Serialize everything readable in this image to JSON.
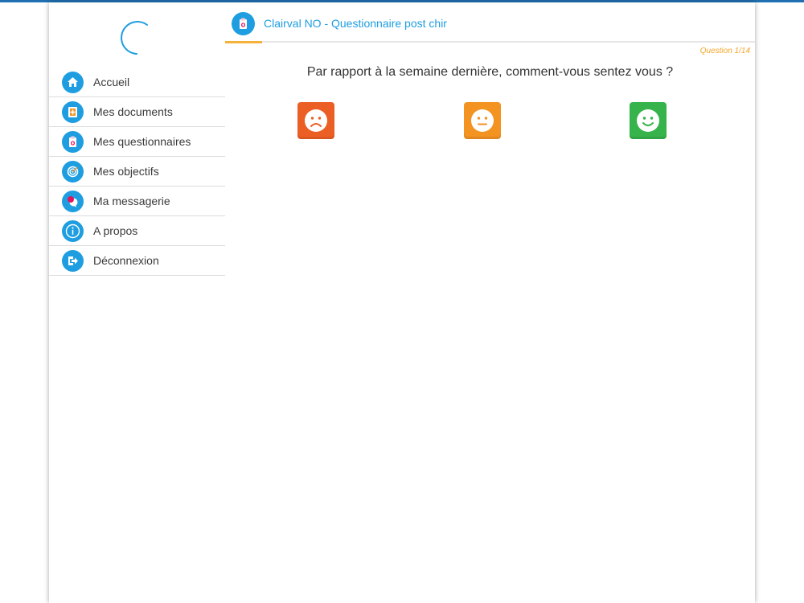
{
  "header": {
    "title": "Clairval NO - Questionnaire post chir",
    "icon": "clipboard-medical-icon"
  },
  "progress": "Question 1/14",
  "question": "Par rapport à la semaine dernière, comment-vous sentez vous ?",
  "answers": [
    {
      "name": "sad-face-icon",
      "color": "#ec5f24"
    },
    {
      "name": "neutral-face-icon",
      "color": "#f39322"
    },
    {
      "name": "happy-face-icon",
      "color": "#36b34a"
    }
  ],
  "sidebar": {
    "items": [
      {
        "label": "Accueil",
        "icon": "home-icon"
      },
      {
        "label": "Mes documents",
        "icon": "documents-icon"
      },
      {
        "label": "Mes questionnaires",
        "icon": "questionnaire-icon"
      },
      {
        "label": "Mes objectifs",
        "icon": "target-icon"
      },
      {
        "label": "Ma messagerie",
        "icon": "message-icon"
      },
      {
        "label": "A propos",
        "icon": "info-icon"
      },
      {
        "label": "Déconnexion",
        "icon": "logout-icon"
      }
    ]
  },
  "colors": {
    "accent": "#1e9ee0",
    "progress": "#f4a62a",
    "tab_indicator": "#f4b23a",
    "top_strip": "#1f6fb2"
  }
}
